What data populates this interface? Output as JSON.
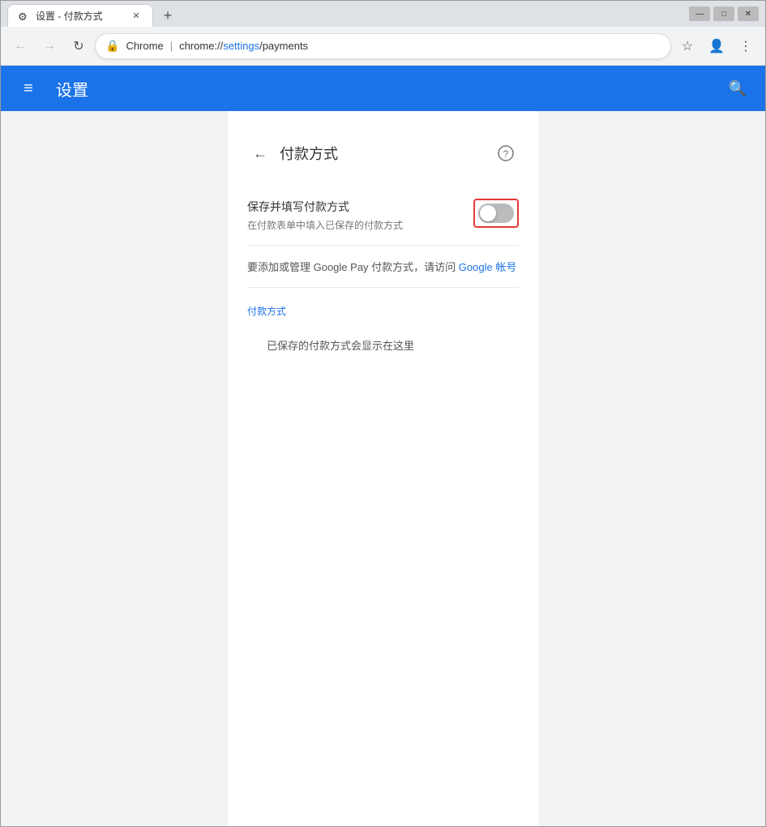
{
  "window": {
    "title": "设置 - 付款方式"
  },
  "tab": {
    "label": "设置 - 付款方式",
    "favicon": "⚙"
  },
  "tabs": {
    "new_label": "+"
  },
  "window_controls": {
    "minimize": "—",
    "maximize": "□",
    "close": "✕"
  },
  "address_bar": {
    "back": "←",
    "forward": "→",
    "refresh": "↻",
    "chrome_label": "Chrome",
    "separator": "|",
    "url_prefix": "chrome://",
    "url_path": "settings",
    "url_suffix": "/payments",
    "star": "☆",
    "account": "👤",
    "more": "⋮"
  },
  "header": {
    "menu_icon": "≡",
    "title": "设置",
    "search_icon": "🔍"
  },
  "page": {
    "back_icon": "←",
    "title": "付款方式",
    "help_icon": "?",
    "save_fill_title": "保存并填写付款方式",
    "save_fill_subtitle": "在付款表单中填入已保存的付款方式",
    "toggle_state": "off",
    "google_pay_text_before": "要添加或管理 Google Pay 付款方式，请访问",
    "google_pay_link": "Google 帐号",
    "section_label": "付款方式",
    "empty_message": "已保存的付款方式会显示在这里"
  }
}
